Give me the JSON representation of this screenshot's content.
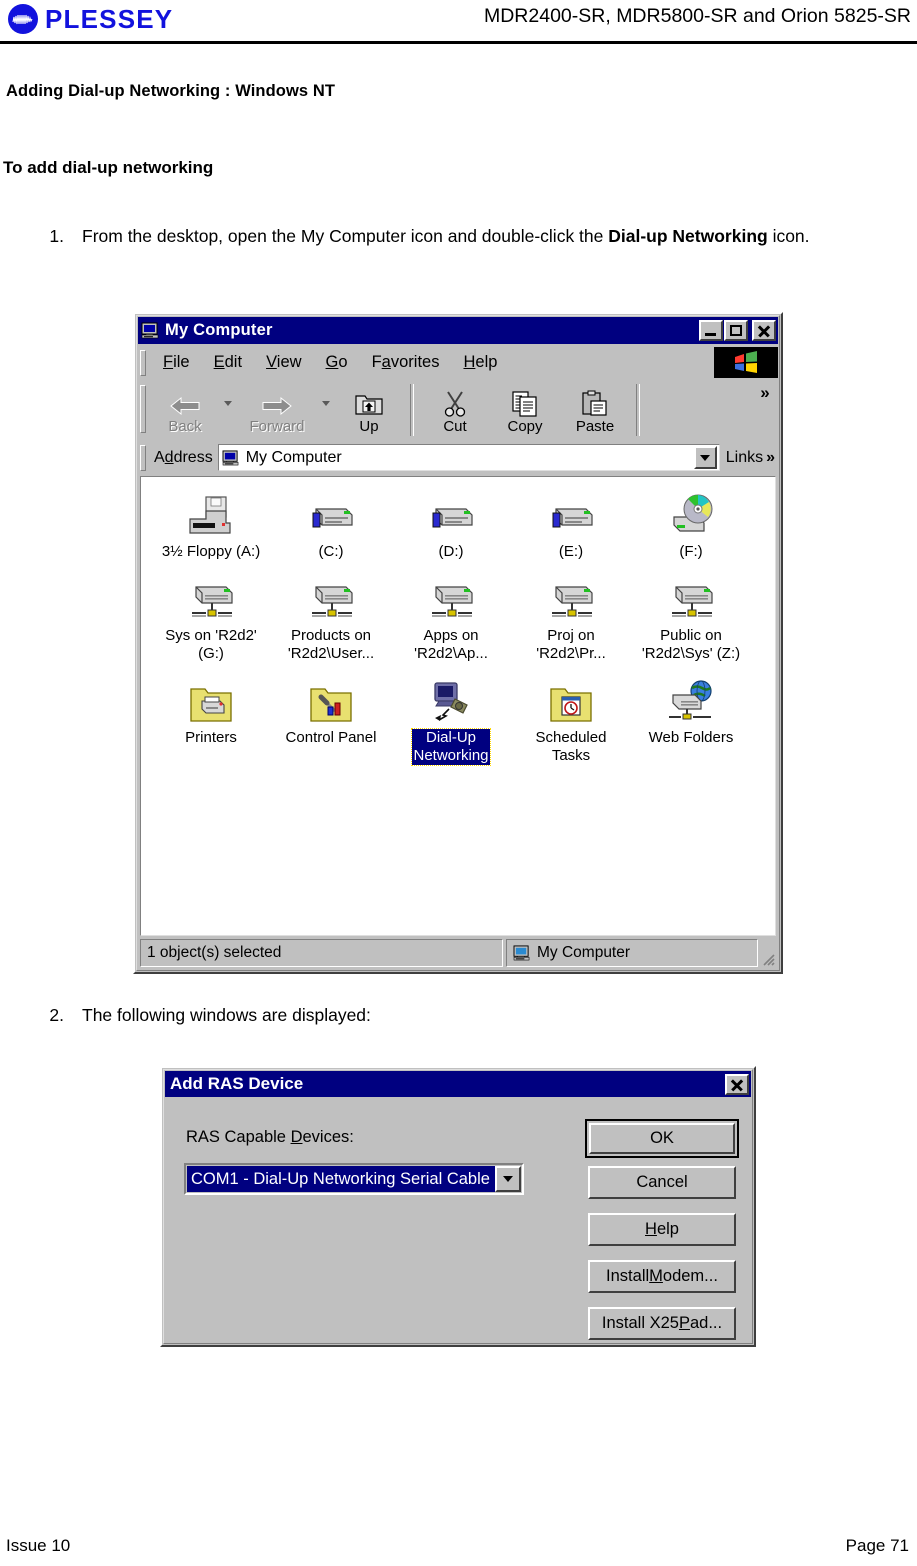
{
  "header": {
    "brand": "PLESSEY",
    "brand_icon": "plessey-waveform-logo",
    "models": "MDR2400-SR, MDR5800-SR and Orion 5825-SR"
  },
  "document": {
    "section_title": "Adding Dial-up Networking : Windows NT",
    "subsection_title": "To add dial-up networking",
    "steps": [
      {
        "number": "1.",
        "text_parts": [
          {
            "text": "From the desktop, open the My Computer icon and double-click the ",
            "bold": false
          },
          {
            "text": "Dial-up Networking",
            "bold": true
          },
          {
            "text": " icon.",
            "bold": false
          }
        ]
      },
      {
        "number": "2.",
        "text_parts": [
          {
            "text": "The following windows are displayed:",
            "bold": false
          }
        ]
      }
    ]
  },
  "footer": {
    "left": "Issue 10",
    "right": "Page 71"
  },
  "my_computer_window": {
    "title": "My Computer",
    "title_icon": "computer-icon",
    "title_buttons": [
      {
        "name": "minimize",
        "glyph": "_"
      },
      {
        "name": "maximize",
        "glyph": "□"
      },
      {
        "name": "close",
        "glyph": "✕"
      }
    ],
    "menu": [
      {
        "label": "File",
        "accel": "F"
      },
      {
        "label": "Edit",
        "accel": "E"
      },
      {
        "label": "View",
        "accel": "V"
      },
      {
        "label": "Go",
        "accel": "G"
      },
      {
        "label": "Favorites",
        "accel": "a"
      },
      {
        "label": "Help",
        "accel": "H"
      }
    ],
    "menu_logo": "windows-flag-icon",
    "toolbar": [
      {
        "label": "Back",
        "icon": "back-arrow-icon",
        "disabled": true,
        "has_dropdown": true
      },
      {
        "label": "Forward",
        "icon": "forward-arrow-icon",
        "disabled": true,
        "has_dropdown": true
      },
      {
        "label": "Up",
        "icon": "up-folder-icon",
        "disabled": false,
        "has_dropdown": false
      },
      {
        "label": "Cut",
        "icon": "scissors-icon",
        "disabled": false,
        "has_dropdown": false
      },
      {
        "label": "Copy",
        "icon": "copy-pages-icon",
        "disabled": false,
        "has_dropdown": false
      },
      {
        "label": "Paste",
        "icon": "clipboard-icon",
        "disabled": false,
        "has_dropdown": false
      }
    ],
    "toolbar_overflow": "»",
    "address": {
      "label": "Address",
      "label_accel": "d",
      "value": "My Computer",
      "icon": "computer-icon",
      "dropdown_icon": "chevron-down-icon"
    },
    "links": {
      "label": "Links",
      "chevron": "»"
    },
    "items": [
      [
        {
          "label": "3½ Floppy (A:)",
          "icon": "floppy-drive-icon",
          "selected": false
        },
        {
          "label": "(C:)",
          "icon": "hard-drive-icon",
          "selected": false
        },
        {
          "label": "(D:)",
          "icon": "hard-drive-icon",
          "selected": false
        },
        {
          "label": "(E:)",
          "icon": "hard-drive-icon",
          "selected": false
        },
        {
          "label": "(F:)",
          "icon": "cdrom-drive-icon",
          "selected": false
        }
      ],
      [
        {
          "label": "Sys on 'R2d2'\n(G:)",
          "icon": "network-drive-icon",
          "selected": false
        },
        {
          "label": "Products on\n'R2d2\\User...",
          "icon": "network-drive-icon",
          "selected": false
        },
        {
          "label": "Apps on\n'R2d2\\Ap...",
          "icon": "network-drive-icon",
          "selected": false
        },
        {
          "label": "Proj on\n'R2d2\\Pr...",
          "icon": "network-drive-icon",
          "selected": false
        },
        {
          "label": "Public on\n'R2d2\\Sys' (Z:)",
          "icon": "network-drive-icon",
          "selected": false
        }
      ],
      [
        {
          "label": "Printers",
          "icon": "printers-folder-icon",
          "selected": false
        },
        {
          "label": "Control Panel",
          "icon": "control-panel-folder-icon",
          "selected": false
        },
        {
          "label": "Dial-Up\nNetworking",
          "icon": "dialup-networking-icon",
          "selected": true
        },
        {
          "label": "Scheduled\nTasks",
          "icon": "scheduled-tasks-folder-icon",
          "selected": false
        },
        {
          "label": "Web Folders",
          "icon": "web-folders-icon",
          "selected": false
        }
      ]
    ],
    "status": {
      "left": "1 object(s) selected",
      "right": "My Computer",
      "right_icon": "computer-icon"
    }
  },
  "ras_dialog": {
    "title": "Add RAS Device",
    "close_glyph": "✕",
    "devices_label": "RAS Capable Devices:",
    "devices_label_accel": "D",
    "selected_device": "COM1 - Dial-Up Networking Serial Cable",
    "combo_arrow_icon": "chevron-down-icon",
    "buttons": [
      {
        "id": "ok",
        "label": "OK",
        "accel": "",
        "default": true
      },
      {
        "id": "cancel",
        "label": "Cancel",
        "accel": "",
        "default": false
      },
      {
        "id": "help",
        "label": "Help",
        "accel": "H",
        "default": false
      },
      {
        "id": "install_modem",
        "label": "Install Modem...",
        "accel": "M",
        "default": false
      },
      {
        "id": "install_x25",
        "label": "Install X25 Pad...",
        "accel": "P",
        "default": false
      }
    ]
  },
  "colors": {
    "brand_blue": "#1212dd",
    "titlebar_blue": "#000080",
    "window_face": "#c0c0c0",
    "selection_blue": "#000080"
  }
}
